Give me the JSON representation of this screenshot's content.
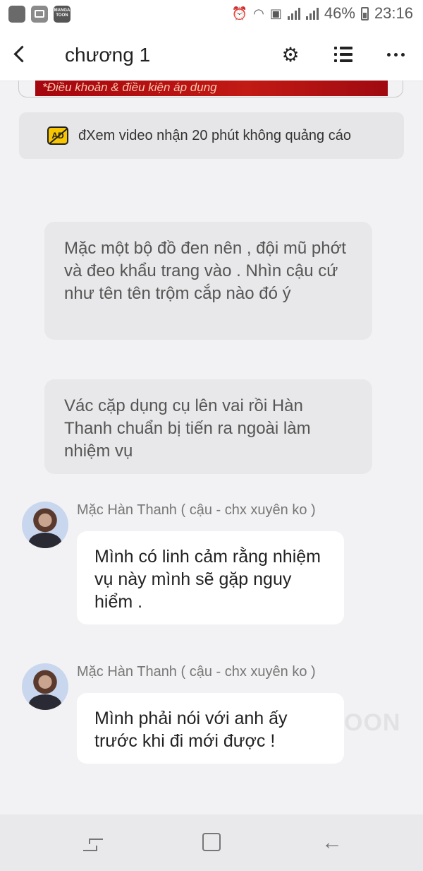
{
  "status_bar": {
    "app_icons": [
      "app-icon",
      "gallery-icon",
      "manga-toon-icon"
    ],
    "manga_label": "MANGA TOON",
    "battery": "46%",
    "time": "23:16"
  },
  "header": {
    "title": "chương 1"
  },
  "banner": {
    "text": "*Điều khoản & điều kiện áp dụng"
  },
  "ad_bar": {
    "icon_text": "AD",
    "text": "đXem video nhận 20 phút không quảng cáo"
  },
  "narrations": [
    "Mặc một bộ đồ đen nên , đội mũ phớt và đeo khẩu trang vào . Nhìn cậu cứ như tên tên trộm cắp nào đó ý",
    "Vác cặp dụng cụ lên vai rồi Hàn Thanh chuẩn bị tiến ra ngoài làm nhiệm vụ"
  ],
  "messages": [
    {
      "speaker": "Mặc Hàn Thanh ( cậu - chx xuyên ko )",
      "text": "Mình có linh cảm rằng nhiệm vụ này mình sẽ gặp nguy hiểm ."
    },
    {
      "speaker": "Mặc Hàn Thanh ( cậu - chx xuyên ko )",
      "text": "Mình phải nói với anh ấy trước khi đi mới được !"
    }
  ],
  "watermark": "OON",
  "colors": {
    "background": "#f2f2f4",
    "banner": "#b0100f",
    "bubble": "#ffffff",
    "narration": "#e8e8ea"
  }
}
